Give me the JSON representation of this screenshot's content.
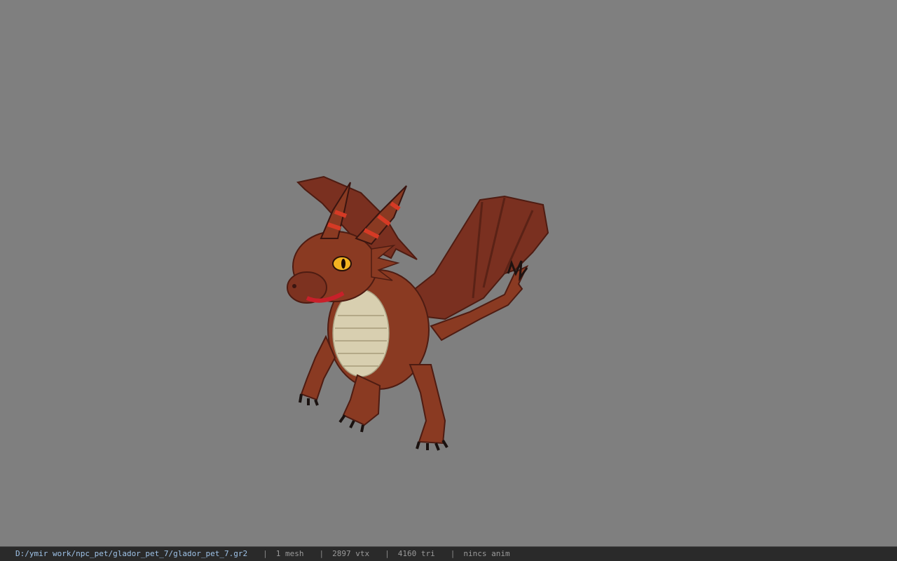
{
  "viewport": {
    "background": "#7f7f7f",
    "model": {
      "icon": "dragon-model",
      "body_color": "#8a3a22",
      "belly_color": "#d8cfb0",
      "wing_color": "#7a3020",
      "horn_stripe_color": "#d63a25",
      "eye_color": "#f2b321"
    }
  },
  "status": {
    "file_path": "D:/ymir work/npc_pet/glador_pet_7/glador_pet_7.gr2",
    "separator": "|",
    "meshes": "1 mesh",
    "vertices": "2897 vtx",
    "triangles": "4160 tri",
    "animation": "nincs anim"
  }
}
